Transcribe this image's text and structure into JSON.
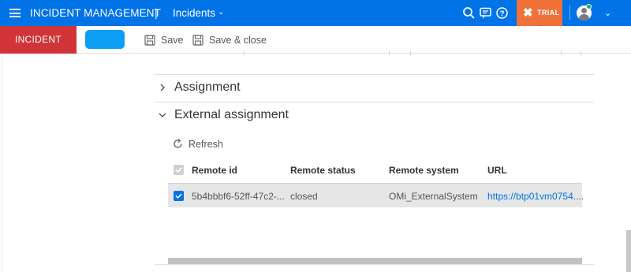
{
  "header": {
    "app_title": "INCIDENT MANAGEMENT",
    "separator": "|",
    "module": "Incidents",
    "trial_label": "TRIAL",
    "icons": [
      "search-icon",
      "chat-icon",
      "help-icon",
      "trial-x-icon",
      "user-avatar-icon",
      "chevron-down-icon"
    ]
  },
  "toolbar": {
    "record_type": "INCIDENT",
    "save_label": "Save",
    "save_close_label": "Save & close"
  },
  "sections": [
    {
      "title": "Assignment",
      "expanded": false
    },
    {
      "title": "External assignment",
      "expanded": true
    }
  ],
  "external_assignment": {
    "refresh_label": "Refresh",
    "columns": [
      "Remote id",
      "Remote status",
      "Remote system",
      "URL"
    ],
    "rows": [
      {
        "checked": true,
        "remote_id": "5b4bbbf6-52ff-47c2-...",
        "remote_status": "closed",
        "remote_system": "OMi_ExternalSystem",
        "url": "https://btp01vm0754...."
      }
    ]
  },
  "colors": {
    "header_bg": "#0073e7",
    "record_type_bg": "#d13438",
    "trial_bg": "#f0713a",
    "link": "#0073e7",
    "selected_row_bg": "#e6e6e6"
  }
}
